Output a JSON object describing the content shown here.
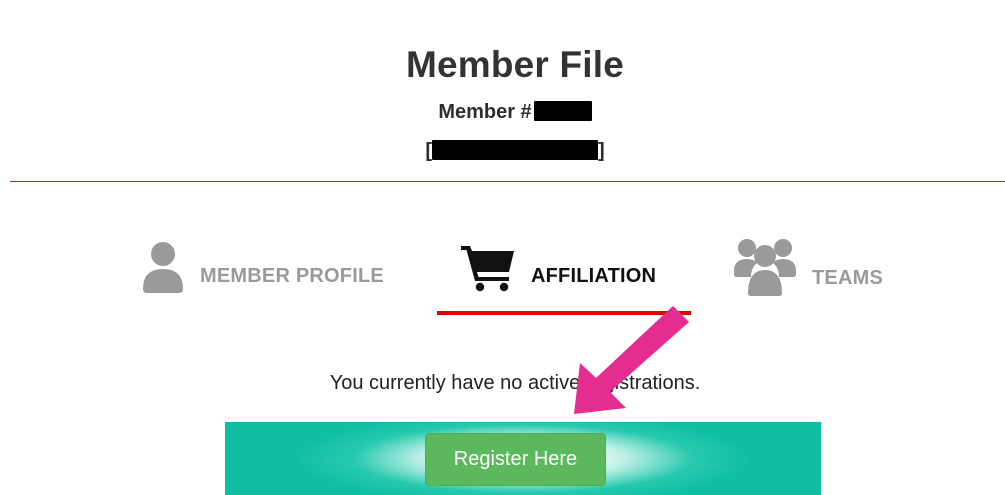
{
  "header": {
    "title": "Member File",
    "member_number_prefix": "Member #",
    "member_name_open": "[",
    "member_name_close": "]"
  },
  "tabs": [
    {
      "label": "MEMBER PROFILE",
      "icon": "user-icon",
      "active": false
    },
    {
      "label": "AFFILIATION",
      "icon": "shopping-cart-icon",
      "active": true
    },
    {
      "label": "TEAMS",
      "icon": "users-group-icon",
      "active": false
    }
  ],
  "affiliation": {
    "status_text": "You currently have no active registrations.",
    "register_label": "Register Here"
  },
  "colors": {
    "divider": "#c92a2a",
    "active_underline": "#e00000",
    "inactive_tab": "#9a9a9a",
    "register_button": "#5cb85c",
    "banner": "#10bfa3",
    "annotation_arrow": "#e42d8f"
  }
}
